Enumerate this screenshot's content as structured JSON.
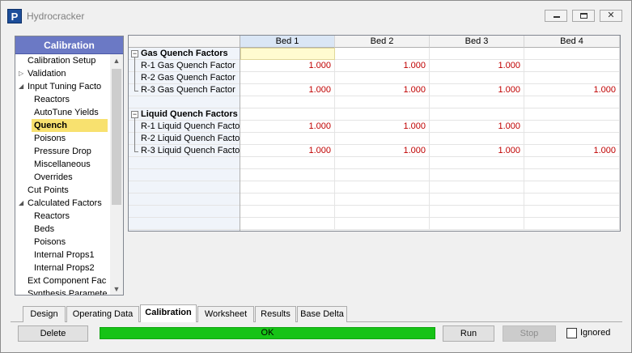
{
  "window": {
    "title": "Hydrocracker",
    "icon_letter": "P",
    "controls": [
      "minimize-icon",
      "maximize-icon",
      "close-icon"
    ]
  },
  "nav": {
    "header": "Calibration",
    "items": [
      {
        "label": "Calibration Setup",
        "level": 0,
        "expander": ""
      },
      {
        "label": "Validation",
        "level": 0,
        "expander": "▷"
      },
      {
        "label": "Input Tuning Facto",
        "level": 0,
        "expander": "◢"
      },
      {
        "label": "Reactors",
        "level": 1,
        "expander": ""
      },
      {
        "label": "AutoTune Yields",
        "level": 1,
        "expander": ""
      },
      {
        "label": "Quench",
        "level": 1,
        "expander": "",
        "selected": true
      },
      {
        "label": "Poisons",
        "level": 1,
        "expander": ""
      },
      {
        "label": "Pressure Drop",
        "level": 1,
        "expander": ""
      },
      {
        "label": "Miscellaneous",
        "level": 1,
        "expander": ""
      },
      {
        "label": "Overrides",
        "level": 1,
        "expander": ""
      },
      {
        "label": "Cut Points",
        "level": 0,
        "expander": ""
      },
      {
        "label": "Calculated Factors",
        "level": 0,
        "expander": "◢"
      },
      {
        "label": "Reactors",
        "level": 1,
        "expander": ""
      },
      {
        "label": "Beds",
        "level": 1,
        "expander": ""
      },
      {
        "label": "Poisons",
        "level": 1,
        "expander": ""
      },
      {
        "label": "Internal Props1",
        "level": 1,
        "expander": ""
      },
      {
        "label": "Internal Props2",
        "level": 1,
        "expander": ""
      },
      {
        "label": "Ext Component Fac",
        "level": 0,
        "expander": ""
      },
      {
        "label": "Synthesis Paramete",
        "level": 0,
        "expander": ""
      }
    ]
  },
  "grid": {
    "columns": [
      "Bed 1",
      "Bed 2",
      "Bed 3",
      "Bed 4"
    ],
    "groups": [
      {
        "title": "Gas Quench Factors",
        "collapse_symbol": "−",
        "rows": [
          {
            "label": "R-1 Gas Quench Factor",
            "values": [
              "1.000",
              "1.000",
              "1.000",
              ""
            ]
          },
          {
            "label": "R-2 Gas Quench Factor",
            "values": [
              "",
              "",
              "",
              ""
            ]
          },
          {
            "label": "R-3 Gas Quench Factor",
            "values": [
              "1.000",
              "1.000",
              "1.000",
              "1.000"
            ]
          }
        ]
      },
      {
        "title": "Liquid Quench Factors",
        "collapse_symbol": "−",
        "rows": [
          {
            "label": "R-1 Liquid Quench Facto",
            "values": [
              "1.000",
              "1.000",
              "1.000",
              ""
            ]
          },
          {
            "label": "R-2 Liquid Quench Facto",
            "values": [
              "",
              "",
              "",
              ""
            ]
          },
          {
            "label": "R-3 Liquid Quench Facto",
            "values": [
              "1.000",
              "1.000",
              "1.000",
              "1.000"
            ]
          }
        ]
      }
    ]
  },
  "tabs": {
    "items": [
      "Design",
      "Operating Data",
      "Calibration",
      "Worksheet",
      "Results",
      "Base Delta"
    ],
    "active": "Calibration"
  },
  "footer": {
    "delete_label": "Delete",
    "status_text": "OK",
    "run_label": "Run",
    "stop_label": "Stop",
    "ignored_label": "Ignored",
    "ignored_checked": false
  },
  "colors": {
    "nav_header": "#6b79c5",
    "selected_item": "#f8e16f",
    "value_text": "#c00000",
    "status_ok": "#16c316"
  }
}
